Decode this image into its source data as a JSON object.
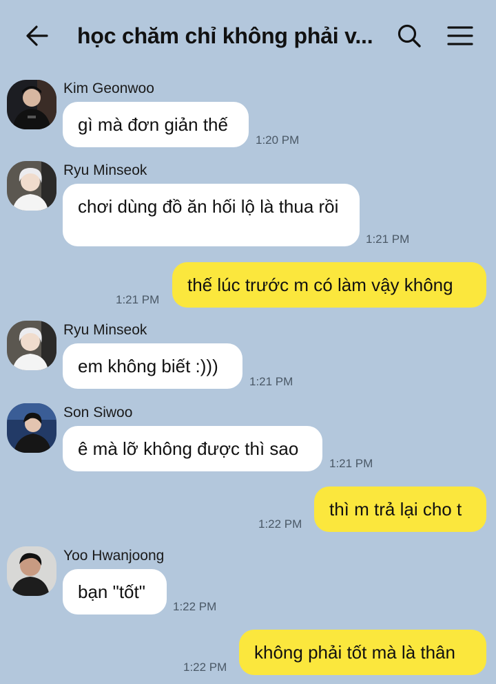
{
  "header": {
    "title": "học chăm chỉ không phải v...",
    "back_icon": "arrow-left-icon",
    "search_icon": "search-icon",
    "menu_icon": "hamburger-menu-icon"
  },
  "colors": {
    "background": "#b3c7dc",
    "incoming_bubble": "#ffffff",
    "outgoing_bubble": "#fbe73d"
  },
  "messages": [
    {
      "direction": "incoming",
      "sender": "Kim Geonwoo",
      "text": "gì mà đơn giản thế",
      "time": "1:20 PM"
    },
    {
      "direction": "incoming",
      "sender": "Ryu Minseok",
      "text": "chơi dùng đồ ăn hối lộ là thua rồi",
      "time": "1:21 PM"
    },
    {
      "direction": "outgoing",
      "text": "thế lúc trước m có làm vậy không",
      "time": "1:21 PM"
    },
    {
      "direction": "incoming",
      "sender": "Ryu Minseok",
      "text": "em không biết :)))",
      "time": "1:21 PM"
    },
    {
      "direction": "incoming",
      "sender": "Son Siwoo",
      "text": "ê mà lỡ không được thì sao",
      "time": "1:21 PM"
    },
    {
      "direction": "outgoing",
      "text": "thì m trả lại cho t",
      "time": "1:22 PM"
    },
    {
      "direction": "incoming",
      "sender": "Yoo Hwanjoong",
      "text": "bạn \"tốt\"",
      "time": "1:22 PM"
    },
    {
      "direction": "outgoing",
      "text": "không phải tốt mà là thân",
      "time": "1:22 PM"
    }
  ]
}
